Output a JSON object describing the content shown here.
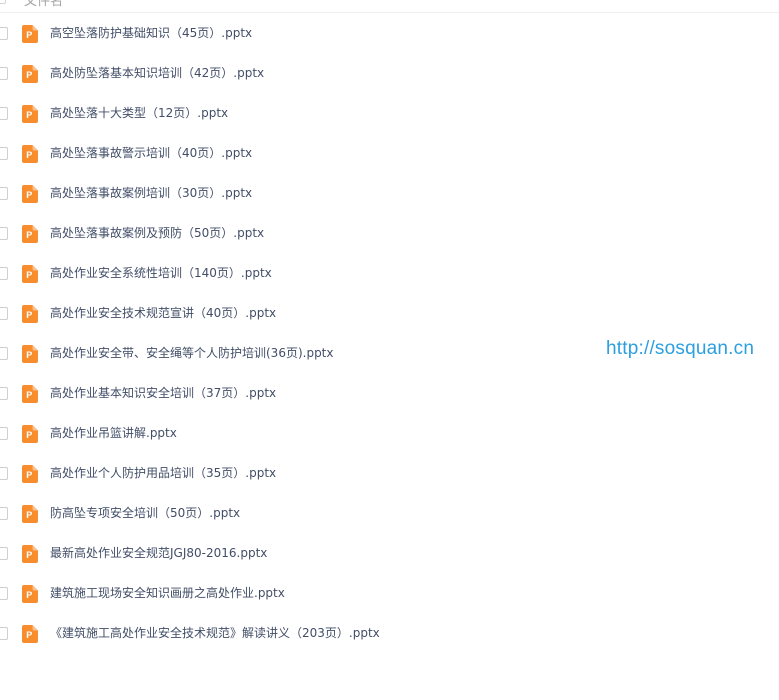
{
  "header": {
    "title": "文件名"
  },
  "file_icon": {
    "name": "pptx-file-icon",
    "letter": "P",
    "color": "#f88d2e"
  },
  "files": [
    "高空坠落防护基础知识（45页）.pptx",
    "高处防坠落基本知识培训（42页）.pptx",
    "高处坠落十大类型（12页）.pptx",
    "高处坠落事故警示培训（40页）.pptx",
    "高处坠落事故案例培训（30页）.pptx",
    "高处坠落事故案例及预防（50页）.pptx",
    "高处作业安全系统性培训（140页）.pptx",
    "高处作业安全技术规范宣讲（40页）.pptx",
    "高处作业安全带、安全绳等个人防护培训(36页).pptx",
    "高处作业基本知识安全培训（37页）.pptx",
    "高处作业吊篮讲解.pptx",
    "高处作业个人防护用品培训（35页）.pptx",
    "防高坠专项安全培训（50页）.pptx",
    "最新高处作业安全规范JGJ80-2016.pptx",
    "建筑施工现场安全知识画册之高处作业.pptx",
    "《建筑施工高处作业安全技术规范》解读讲义（203页）.pptx"
  ],
  "watermark": "http://sosquan.cn"
}
